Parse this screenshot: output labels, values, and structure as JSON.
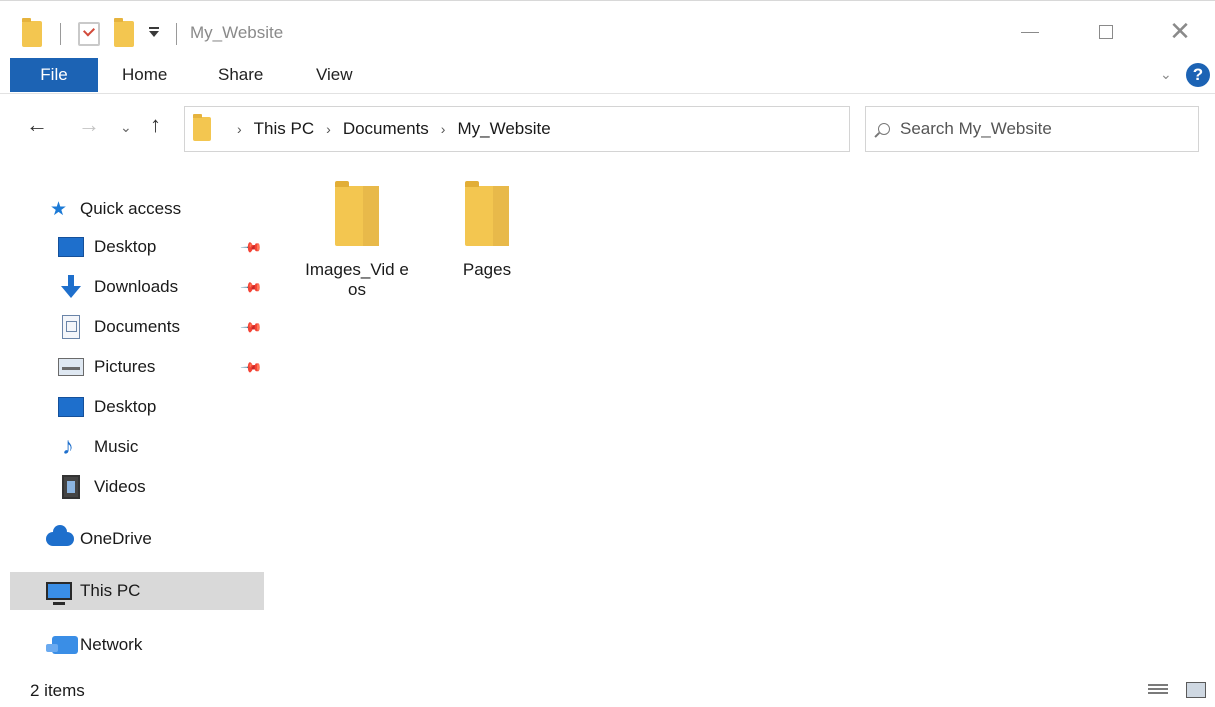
{
  "window": {
    "title": "My_Website",
    "tabs": {
      "file": "File",
      "home": "Home",
      "share": "Share",
      "view": "View"
    },
    "help_label": "?"
  },
  "navigation": {
    "breadcrumbs": [
      "This PC",
      "Documents",
      "My_Website"
    ],
    "search_placeholder": "Search My_Website"
  },
  "sidebar": {
    "quick_access": "Quick access",
    "items": [
      {
        "label": "Desktop",
        "icon": "desktop-icon",
        "pinned": true
      },
      {
        "label": "Downloads",
        "icon": "downloads-icon",
        "pinned": true
      },
      {
        "label": "Documents",
        "icon": "documents-icon",
        "pinned": true
      },
      {
        "label": "Pictures",
        "icon": "pictures-icon",
        "pinned": true
      },
      {
        "label": "Desktop",
        "icon": "desktop-icon",
        "pinned": false
      },
      {
        "label": "Music",
        "icon": "music-icon",
        "pinned": false
      },
      {
        "label": "Videos",
        "icon": "videos-icon",
        "pinned": false
      }
    ],
    "onedrive": "OneDrive",
    "this_pc": "This PC",
    "network": "Network",
    "selected": "This PC"
  },
  "content": {
    "items": [
      {
        "name": "Images_Vid eos",
        "type": "folder"
      },
      {
        "name": "Pages",
        "type": "folder"
      }
    ]
  },
  "status": {
    "item_count": "2 items"
  },
  "colors": {
    "accent": "#1c63b4",
    "folder": "#f3c650",
    "selection": "#d9d9d9"
  }
}
